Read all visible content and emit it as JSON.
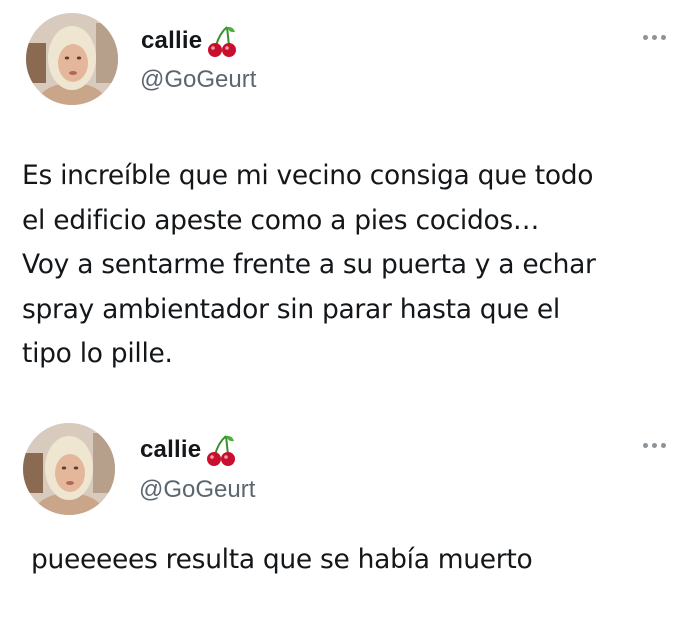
{
  "tweets": [
    {
      "display_name": "callie",
      "name_emoji": "cherry-icon",
      "handle": "@GoGeurt",
      "text": "Es increíble que mi vecino consiga que todo\nel edificio apeste como a pies cocidos…\nVoy a sentarme frente a su puerta y a echar\nspray ambientador sin parar hasta que el\ntipo lo pille.",
      "menu_icon": "more-icon"
    },
    {
      "display_name": "callie",
      "name_emoji": "cherry-icon",
      "handle": "@GoGeurt",
      "text": "pueeeees resulta que se había muerto",
      "menu_icon": "more-icon"
    }
  ],
  "colors": {
    "background": "#ffffff",
    "text": "#14171a",
    "secondary_text": "#5b6670",
    "cherry_red": "#c8102e",
    "stem_green": "#3a8f2e"
  }
}
